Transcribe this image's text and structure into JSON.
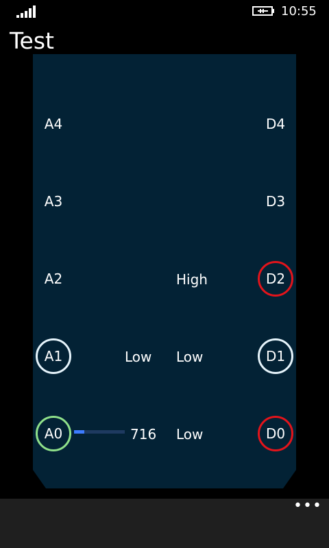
{
  "status": {
    "time": "10:55",
    "signal_icon": "signal-bars-icon",
    "battery_icon": "battery-charging-icon"
  },
  "page": {
    "title": "Test"
  },
  "analog": {
    "A4": {
      "label": "A4"
    },
    "A3": {
      "label": "A3"
    },
    "A2": {
      "label": "A2"
    },
    "A1": {
      "label": "A1",
      "value": "Low"
    },
    "A0": {
      "label": "A0",
      "value": "716",
      "level": 0.2
    }
  },
  "digital": {
    "D4": {
      "label": "D4"
    },
    "D3": {
      "label": "D3"
    },
    "D2": {
      "label": "D2",
      "state": "High"
    },
    "D1": {
      "label": "D1",
      "state": "Low"
    },
    "D0": {
      "label": "D0",
      "state": "Low"
    }
  },
  "colors": {
    "panel": "#032235",
    "ring_white": "#e6f4fb",
    "ring_red": "#e3141b",
    "ring_green": "#8fe08a",
    "slider_fill": "#3d7cff"
  },
  "app_bar": {
    "more_label": "•••"
  }
}
